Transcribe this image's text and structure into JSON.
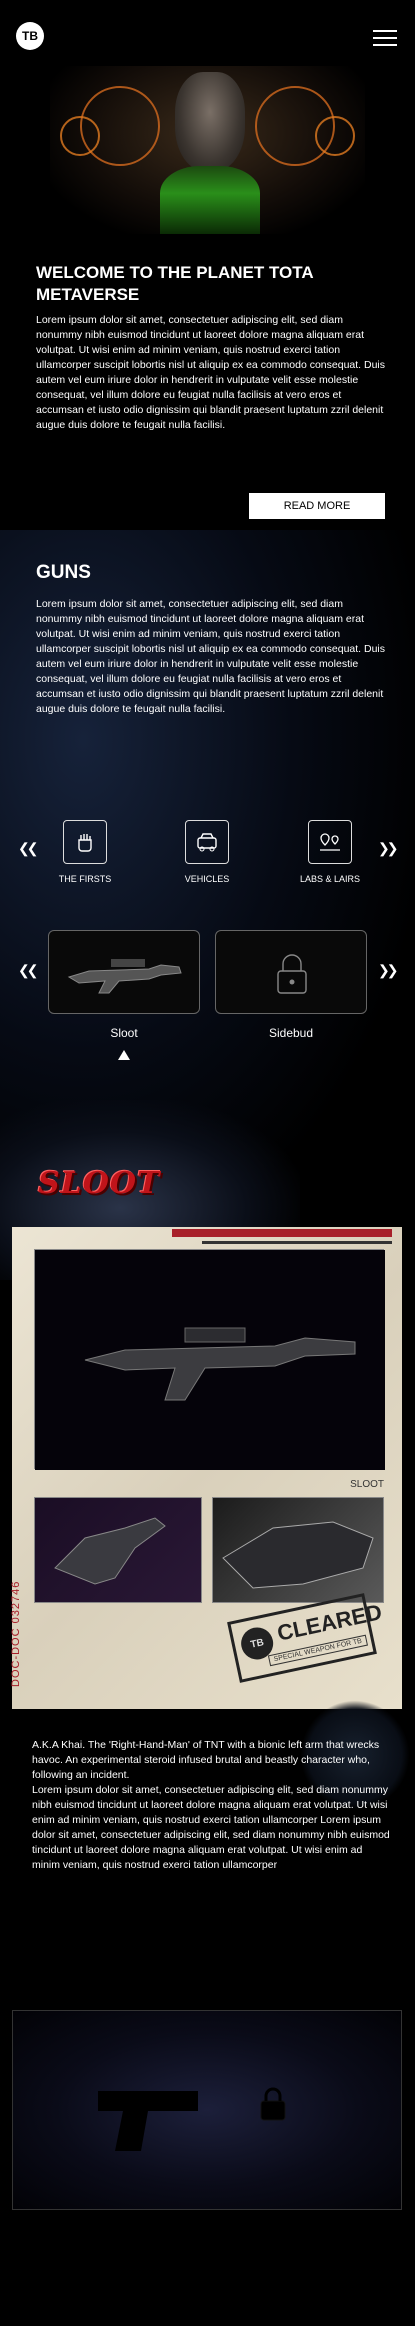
{
  "header": {
    "logo_text": "TB",
    "menu_icon": "hamburger-icon"
  },
  "intro": {
    "title": "WELCOME TO THE PLANET TOTA METAVERSE",
    "body": "Lorem ipsum dolor sit amet, consectetuer adipiscing elit, sed diam nonummy nibh euismod tincidunt ut laoreet dolore magna aliquam erat volutpat. Ut wisi enim ad minim veniam, quis nostrud exerci tation ullamcorper suscipit lobortis nisl ut aliquip ex ea commodo consequat. Duis autem vel eum iriure dolor in hendrerit in vulputate velit esse molestie consequat, vel illum dolore eu feugiat nulla facilisis at vero eros et accumsan et iusto odio dignissim qui blandit praesent luptatum zzril delenit augue duis dolore te feugait nulla facilisi.",
    "read_more": "READ MORE"
  },
  "guns": {
    "title": "GUNS",
    "body": "Lorem ipsum dolor sit amet, consectetuer adipiscing elit, sed diam nonummy nibh euismod tincidunt ut laoreet dolore magna aliquam erat volutpat. Ut wisi enim ad minim veniam, quis nostrud exerci tation ullamcorper suscipit lobortis nisl ut aliquip ex ea commodo consequat. Duis autem vel eum iriure dolor in hendrerit in vulputate velit esse molestie consequat, vel illum dolore eu feugiat nulla facilisis at vero eros et accumsan et iusto odio dignissim qui blandit praesent luptatum zzril delenit augue duis dolore te feugait nulla facilisi."
  },
  "categories": [
    {
      "label": "THE FIRSTS",
      "icon": "fist-icon"
    },
    {
      "label": "VEHICLES",
      "icon": "vehicle-icon"
    },
    {
      "label": "LABS & LAIRS",
      "icon": "map-pin-icon"
    }
  ],
  "weapons": [
    {
      "label": "Sloot",
      "icon": "rifle-icon",
      "locked": false
    },
    {
      "label": "Sidebud",
      "icon": "lock-icon",
      "locked": true
    }
  ],
  "sloot": {
    "logo": "SLOOT",
    "photo_label": "SLOOT",
    "doc_code": "DOC-DOC 032746",
    "stamp": "CLEARED",
    "stamp_sub": "SPECIAL WEAPON FOR TB",
    "description": "A.K.A Khai. The 'Right-Hand-Man' of TNT with a bionic left arm that wrecks havoc. An experimental steroid infused brutal and beastly character who, following an incident.\nLorem ipsum dolor sit amet, consectetuer adipiscing elit, sed diam nonummy nibh euismod tincidunt ut laoreet dolore magna aliquam erat volutpat. Ut wisi enim ad minim veniam, quis nostrud exerci tation ullamcorper Lorem ipsum dolor sit amet, consectetuer adipiscing elit, sed diam nonummy nibh euismod tincidunt ut laoreet dolore magna aliquam erat volutpat. Ut wisi enim ad minim veniam, quis nostrud exerci tation ullamcorper"
  },
  "colors": {
    "accent_red": "#c0141a",
    "background": "#000000",
    "paper": "#e6dfcf"
  }
}
